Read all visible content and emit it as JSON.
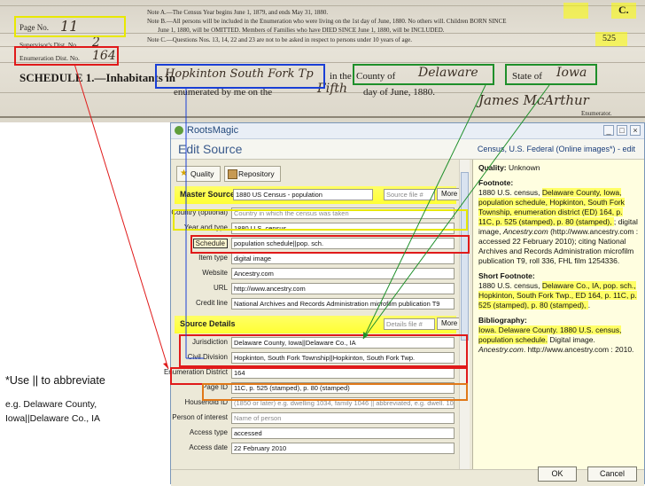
{
  "census": {
    "page_label": "Page No.",
    "supervisor_label": "Supervisor's Dist. No.",
    "enumeration_label": "Enumeration Dist. No.",
    "enumeration_value": "164",
    "note_a": "Note A.—The Census Year begins June 1, 1879, and ends May 31, 1880.",
    "note_b": "Note B.—All persons will be included in the Enumeration who were living on the 1st day of June, 1880. No others will. Children BORN SINCE",
    "note_b2": "June 1, 1880, will be OMITTED. Members of Families who have DIED SINCE June 1, 1880, will be INCLUDED.",
    "note_c": "Note C.—Questions Nos. 13, 14, 22 and 23 are not to be asked in respect to persons under 10 years of age.",
    "schedule": "SCHEDULE 1.—Inhabitants in",
    "township_hand": "Hopkinton South Fork Tp",
    "in_the": "in the",
    "county_label": "County of",
    "county_hand": "Delaware",
    "state_label": "State of",
    "state_hand": "Iowa",
    "enumerated": "enumerated by me on the",
    "day_hand": "Fifth",
    "day_of": "day of June, 1880.",
    "signature": "James McArthur",
    "enumerator": "Enumerator.",
    "page_stamp": "525",
    "corner_c": "C."
  },
  "window": {
    "title": "RootsMagic",
    "header": "Edit Source",
    "header_right": "Census, U.S. Federal (Online images*) - edit",
    "toolbar": {
      "quality": "Quality",
      "repository": "Repository"
    },
    "master_source_label": "Master Source",
    "master_source_value": "1880 US Census - population",
    "source_file_placeholder": "Source file #",
    "more_label": "More",
    "fields": [
      {
        "label": "Country (optional)",
        "value": "Country in which the census was taken",
        "placeholder": true
      },
      {
        "label": "Year and type",
        "value": "1880 U.S. census"
      },
      {
        "label": "Schedule",
        "value": "population schedule||pop. sch."
      },
      {
        "label": "Item type",
        "value": "digital image"
      },
      {
        "label": "Website",
        "value": "Ancestry.com"
      },
      {
        "label": "URL",
        "value": "http://www.ancestry.com"
      },
      {
        "label": "Credit line",
        "value": "National Archives and Records Administration microfilm publication T9"
      }
    ],
    "source_details_label": "Source Details",
    "details_file_placeholder": "Details file #",
    "details": [
      {
        "label": "Jurisdiction",
        "value": "Delaware County, Iowa||Delaware Co., IA"
      },
      {
        "label": "Civil Division",
        "value": "Hopkinton, South Fork Township||Hopkinton, South Fork Twp."
      },
      {
        "label": "Enumeration District",
        "value": "164"
      },
      {
        "label": "Page ID",
        "value": "11C, p. 525 (stamped), p. 80 (stamped)"
      },
      {
        "label": "Household ID",
        "value": "(1850 or later) e.g. dwelling 1034, family 1046 || abbreviated, e.g. dwell. 10",
        "placeholder": true
      },
      {
        "label": "Person of interest",
        "value": "Name of person",
        "placeholder": true
      },
      {
        "label": "Access type",
        "value": "accessed"
      },
      {
        "label": "Access date",
        "value": "22 February 2010"
      }
    ],
    "right": {
      "quality_label": "Quality:",
      "quality_value": "Unknown",
      "footnote_label": "Footnote:",
      "footnote_lines": [
        "1880 U.S. census, ",
        "Delaware County, Iowa, population schedule, Hopkinton, South Fork Township, enumeration district (ED) 164, p. 11C, p. 525 (stamped), p. 80 (stamped), ",
        "; digital image, ",
        "Ancestry.com",
        " (http://www.ancestry.com : accessed 22 February 2010); citing National Archives and Records Administration microfilm publication T9, roll 336, FHL film 1254336."
      ],
      "short_label": "Short Footnote:",
      "short_lines": [
        "1880 U.S. census, ",
        "Delaware Co., IA, pop. sch., Hopkinton, South Fork Twp., ED 164, p. 11C, p. 525 (stamped), p. 80 (stamped), ",
        "."
      ],
      "bib_label": "Bibliography:",
      "bib_lines": [
        "Iowa. Delaware County. 1880 U.S. census, population schedule.",
        " Digital image. ",
        "Ancestry.com",
        ". http://www.ancestry.com : 2010."
      ]
    },
    "ok": "OK",
    "cancel": "Cancel"
  },
  "annotation": {
    "title": "*Use || to abbreviate",
    "example1": "e.g. Delaware County,",
    "example2": "Iowa||Delaware Co., IA"
  },
  "colors": {
    "red_box": "#e01a1a",
    "blue_box": "#1a3fd6",
    "green_box": "#1e8f2a",
    "orange_box": "#e07818",
    "yellow_box": "#e8e800",
    "highlight": "#ffff66"
  }
}
